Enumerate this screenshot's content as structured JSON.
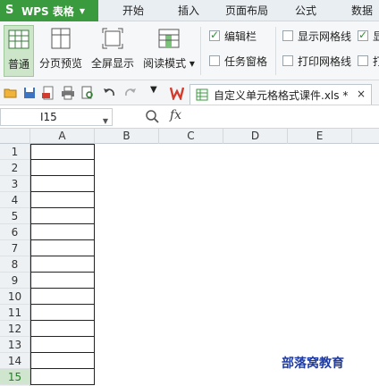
{
  "app": {
    "name": "WPS 表格",
    "logo": "S"
  },
  "menu": {
    "tabs": [
      "开始",
      "插入",
      "页面布局",
      "公式",
      "数据"
    ]
  },
  "ribbon": {
    "views": [
      {
        "label": "普通",
        "icon": "normal-view-icon",
        "active": true
      },
      {
        "label": "分页预览",
        "icon": "page-break-preview-icon",
        "active": false
      },
      {
        "label": "全屏显示",
        "icon": "fullscreen-icon",
        "active": false
      },
      {
        "label": "阅读模式",
        "icon": "reading-mode-icon",
        "active": false
      }
    ],
    "checks": [
      {
        "label": "编辑栏",
        "checked": true
      },
      {
        "label": "任务窗格",
        "checked": false
      },
      {
        "label": "显示网格线",
        "checked": false
      },
      {
        "label": "打印网格线",
        "checked": false
      },
      {
        "label": "显",
        "checked": true
      },
      {
        "label": "打",
        "checked": false
      }
    ]
  },
  "document": {
    "tab_title": "自定义单元格格式课件.xls *",
    "close": "×"
  },
  "formula_bar": {
    "name_box": "I15",
    "fx": "fx"
  },
  "sheet": {
    "columns": [
      "A",
      "B",
      "C",
      "D",
      "E"
    ],
    "rows": [
      "1",
      "2",
      "3",
      "4",
      "5",
      "6",
      "7",
      "8",
      "9",
      "10",
      "11",
      "12",
      "13",
      "14",
      "15"
    ],
    "selected_row": "15"
  },
  "watermark": "部落窝教育",
  "colors": {
    "accent": "#3a9b3e",
    "watermark": "#1f3ca5"
  }
}
